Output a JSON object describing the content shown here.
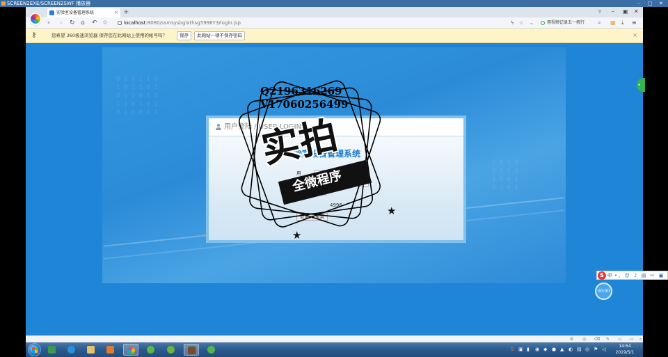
{
  "player": {
    "title": "SCREEN2EXE/SCREEN2SWF 播放器"
  },
  "browser": {
    "tab_title": "实验室设备管理系统",
    "url_host": "localhost",
    "url_path": ":8080/ssmsysbglxthsg5996Y3/login.jsp",
    "record_text": "用视频记录五一假行",
    "colors": {
      "accent": "#1e86d8",
      "infobar": "#fdf4c8"
    }
  },
  "infobar": {
    "message": "您希望 360极速浏览器 保存您在此网站上使用的帐号吗？",
    "save_label": "保存",
    "never_label": "此网站一律不保存密码"
  },
  "login": {
    "header": "用户登陆 / USER LOGIN",
    "system_name": "实验室设备管理系统",
    "user_label": "用",
    "pass_label": "密",
    "code_label": "验证码",
    "code_value": "4996",
    "login_label": "登录",
    "reset_label": "重置"
  },
  "watermark": {
    "qq": "Q2196316269",
    "wx": "V17060256499",
    "big": "实拍",
    "ribbon": "全微程序"
  },
  "widgets": {
    "ime_mode": "中",
    "timer": "00:00"
  },
  "taskbar": {
    "time": "14:54",
    "date": "2019/5/1"
  }
}
